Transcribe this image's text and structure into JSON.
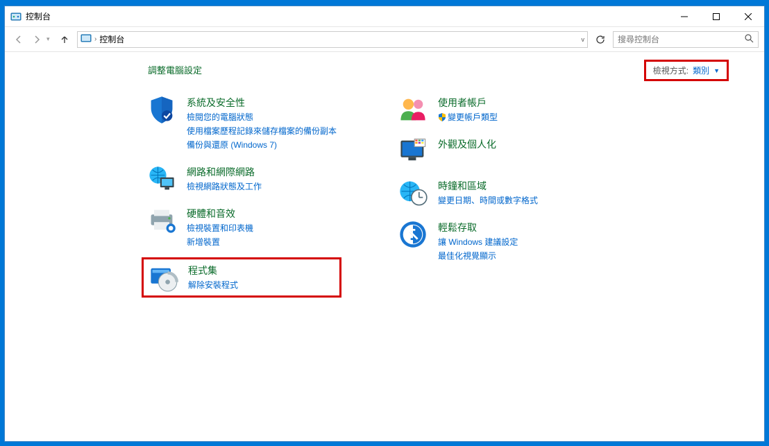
{
  "window": {
    "title": "控制台"
  },
  "nav": {
    "breadcrumb": "控制台",
    "search_placeholder": "搜尋控制台"
  },
  "page": {
    "heading": "調整電腦設定",
    "view_by_label": "檢視方式:",
    "view_by_value": "類別"
  },
  "categories": {
    "left": [
      {
        "title": "系統及安全性",
        "links": [
          "檢閱您的電腦狀態",
          "使用檔案歷程記錄來儲存檔案的備份副本",
          "備份與還原 (Windows 7)"
        ]
      },
      {
        "title": "網路和網際網路",
        "links": [
          "檢視網路狀態及工作"
        ]
      },
      {
        "title": "硬體和音效",
        "links": [
          "檢視裝置和印表機",
          "新增裝置"
        ]
      },
      {
        "title": "程式集",
        "links": [
          "解除安裝程式"
        ]
      }
    ],
    "right": [
      {
        "title": "使用者帳戶",
        "links": [
          "變更帳戶類型"
        ],
        "shield": true
      },
      {
        "title": "外觀及個人化",
        "links": []
      },
      {
        "title": "時鐘和區域",
        "links": [
          "變更日期、時間或數字格式"
        ]
      },
      {
        "title": "輕鬆存取",
        "links": [
          "讓 Windows 建議設定",
          "最佳化視覺顯示"
        ]
      }
    ]
  }
}
